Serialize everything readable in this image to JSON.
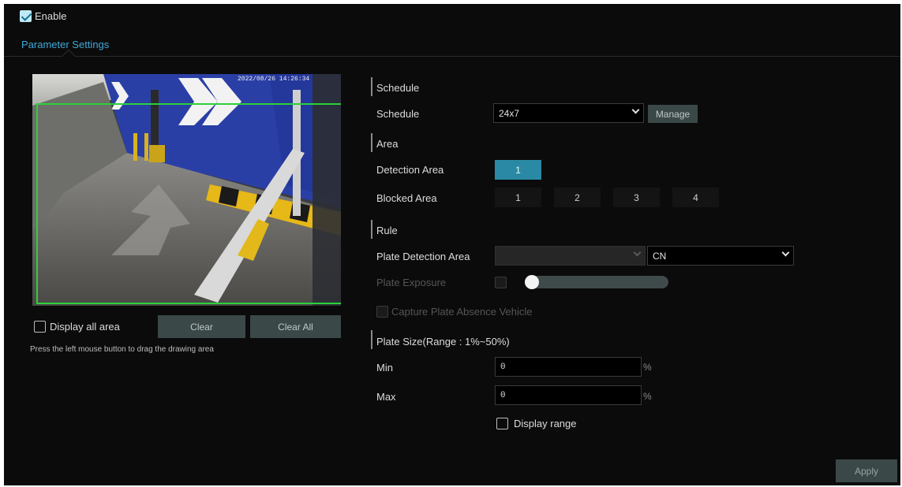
{
  "enable": {
    "label": "Enable",
    "checked": true
  },
  "tab": {
    "label": "Parameter Settings"
  },
  "video": {
    "timestamp": "2022/08/26 14:26:34"
  },
  "left_controls": {
    "display_all_area": "Display all area",
    "clear": "Clear",
    "clear_all": "Clear All",
    "hint": "Press the left mouse button to drag the drawing area"
  },
  "schedule": {
    "section": "Schedule",
    "label": "Schedule",
    "value": "24x7",
    "manage": "Manage"
  },
  "area": {
    "section": "Area",
    "detection_label": "Detection Area",
    "detection_buttons": [
      "1"
    ],
    "blocked_label": "Blocked Area",
    "blocked_buttons": [
      "1",
      "2",
      "3",
      "4"
    ]
  },
  "rule": {
    "section": "Rule",
    "plate_detection_area_label": "Plate Detection Area",
    "plate_detection_area_value": "",
    "country_value": "CN",
    "plate_exposure_label": "Plate Exposure",
    "capture_absence_label": "Capture Plate Absence Vehicle"
  },
  "plate_size": {
    "section": "Plate Size(Range : 1%~50%)",
    "min_label": "Min",
    "min_value": "0",
    "max_label": "Max",
    "max_value": "0",
    "unit": "%",
    "display_range": "Display range"
  },
  "apply": "Apply",
  "colors": {
    "background": "#0b0b0b",
    "accent": "#2a8aa5",
    "tab_text": "#3fa9d8",
    "roi_outline": "#2bd13a",
    "button": "#3b4848"
  }
}
